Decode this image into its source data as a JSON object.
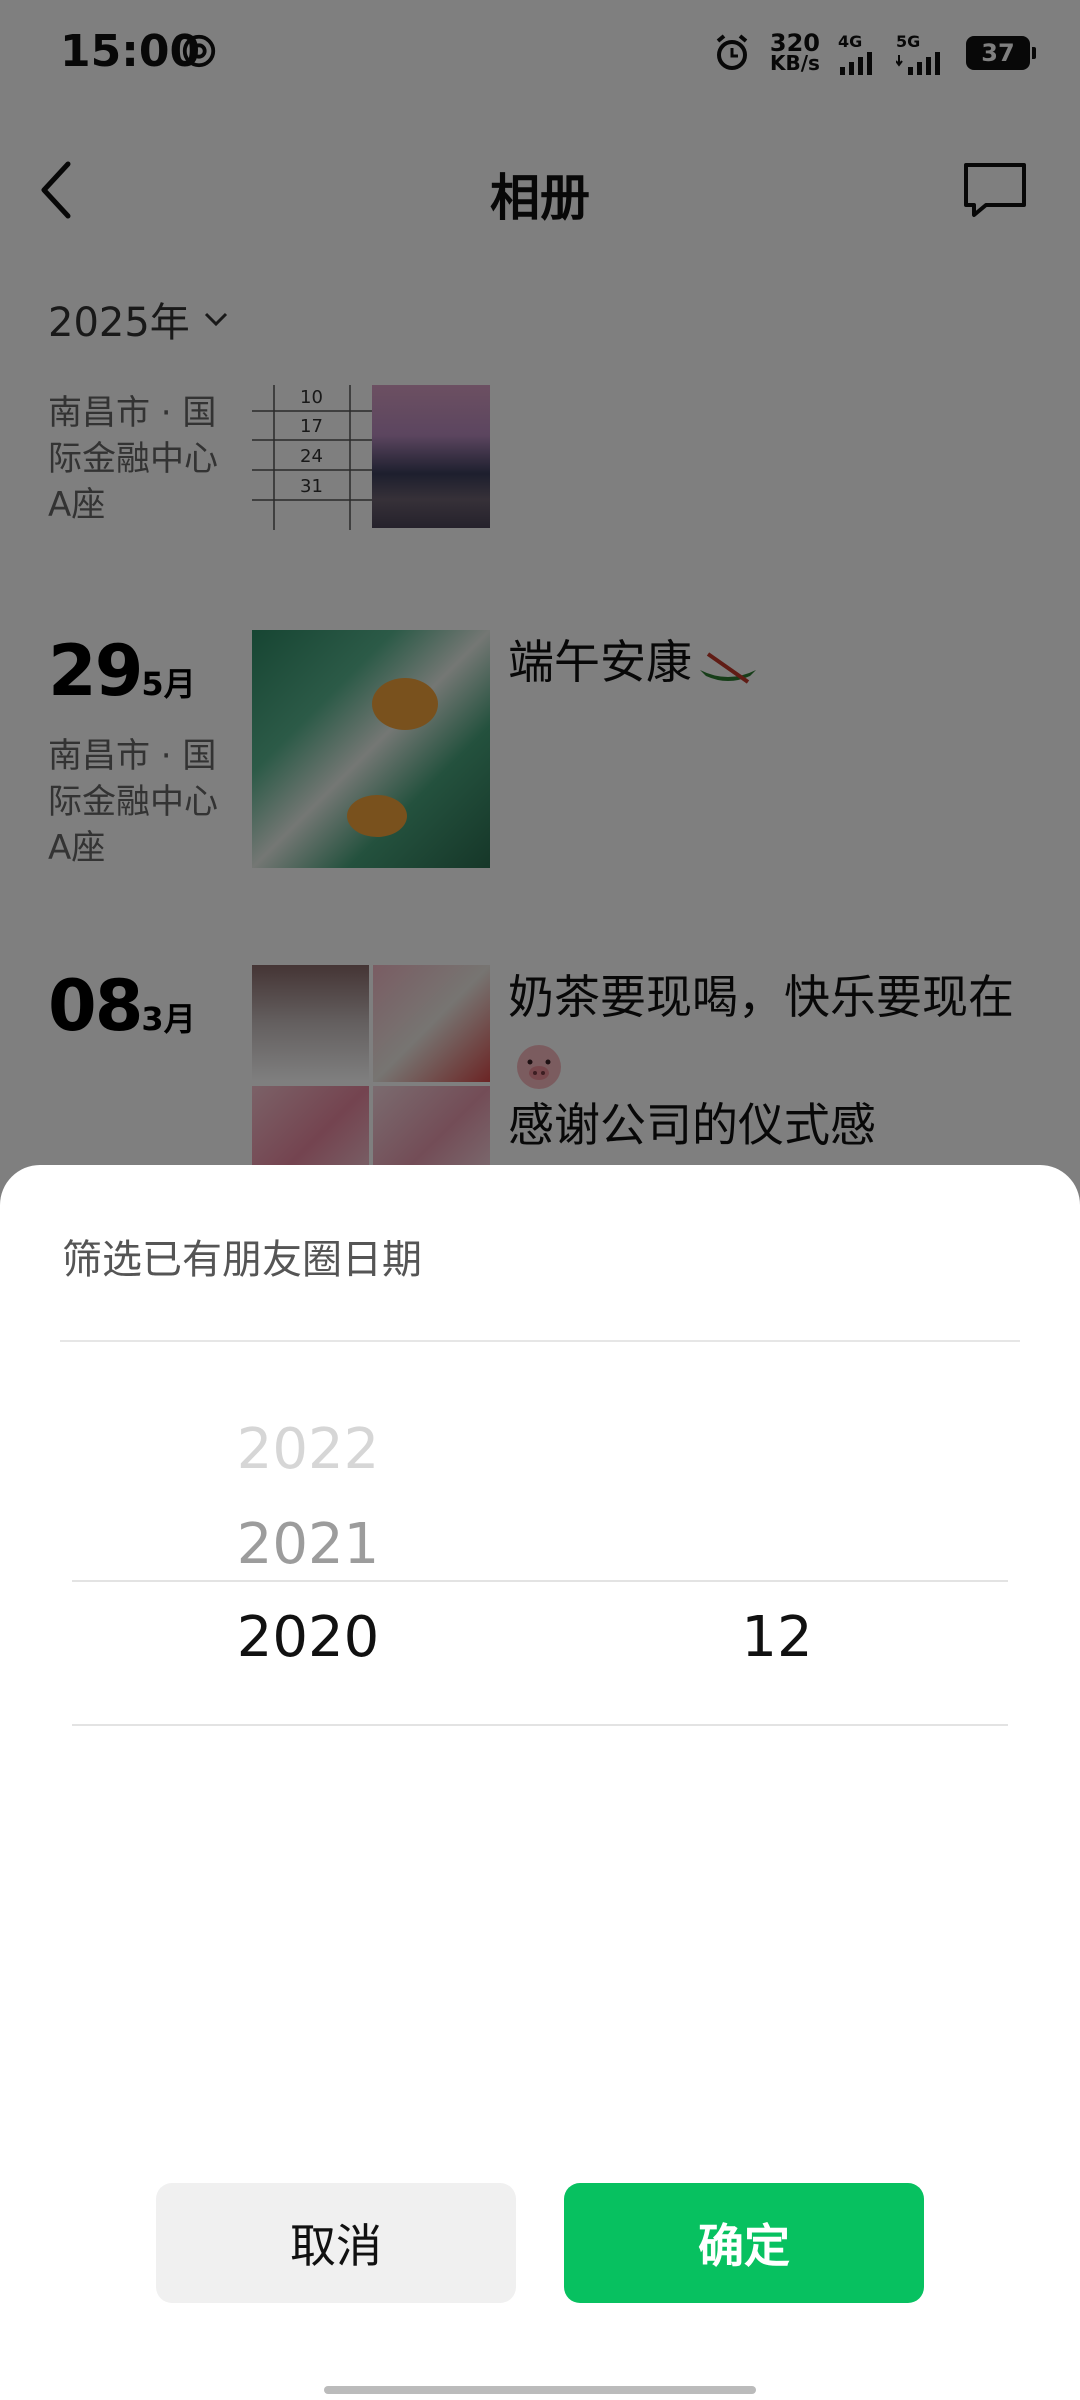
{
  "status_bar": {
    "time": "15:00",
    "speed_value": "320",
    "speed_unit": "KB/s",
    "net1": "4G",
    "net2": "5G",
    "battery": "37"
  },
  "header": {
    "title": "相册",
    "back_icon": "chevron-left-icon",
    "message_icon": "chat-bubble-icon"
  },
  "filter": {
    "year_label": "2025年"
  },
  "feed": {
    "posts": [
      {
        "location": "南昌市 · 国际金融中心A座",
        "calendar_numbers": [
          "10",
          "17",
          "24",
          "31"
        ]
      },
      {
        "day": "29",
        "month": "5月",
        "location": "南昌市 · 国际金融中心A座",
        "text": "端午安康"
      },
      {
        "day": "08",
        "month": "3月",
        "text_line1": "奶茶要现喝，快乐要现在",
        "text_line2": "感谢公司的仪式感"
      }
    ]
  },
  "sheet": {
    "title": "筛选已有朋友圈日期",
    "years": [
      "2022",
      "2021",
      "2020"
    ],
    "selected_year": "2020",
    "selected_month": "12",
    "cancel_label": "取消",
    "confirm_label": "确定"
  },
  "colors": {
    "accent": "#07c160",
    "overlay": "rgba(0,0,0,0.5)"
  }
}
